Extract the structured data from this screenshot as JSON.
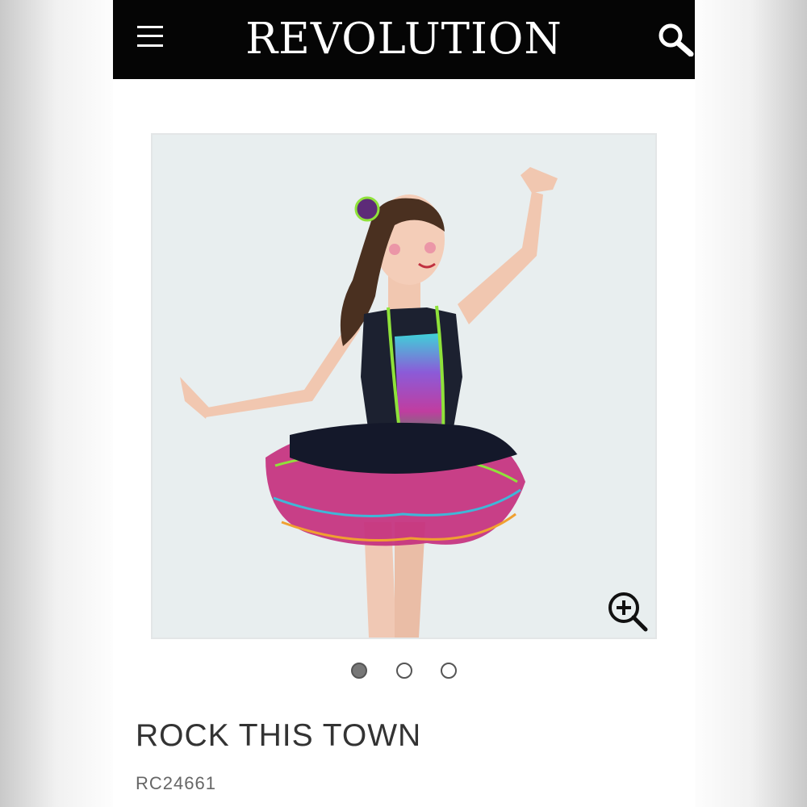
{
  "header": {
    "brand": "REVOLUTION",
    "menu_icon": "hamburger-menu-icon",
    "search_icon": "search-icon",
    "background": "#050505"
  },
  "gallery": {
    "image_subject": "girl in black sequined dance costume with rainbow tutu",
    "zoom_icon": "zoom-in-icon",
    "slides_total": 3,
    "active_slide": 1
  },
  "product": {
    "name": "ROCK THIS TOWN",
    "sku": "RC24661"
  }
}
